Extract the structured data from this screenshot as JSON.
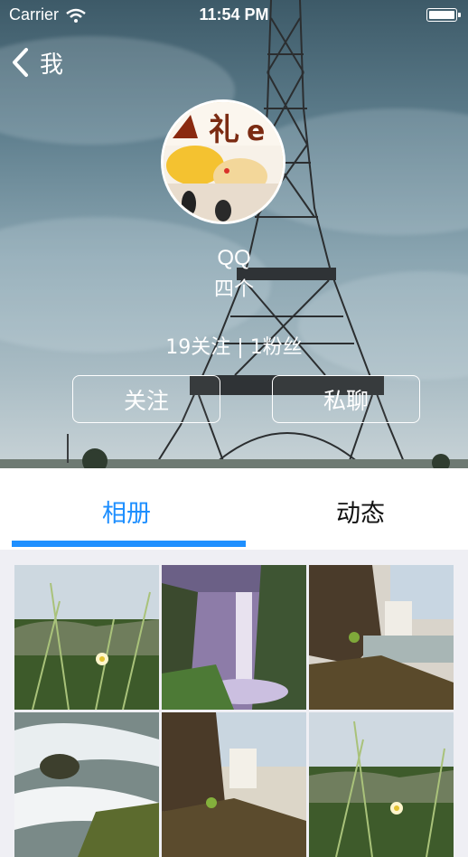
{
  "status_bar": {
    "carrier": "Carrier",
    "time": "11:54 PM"
  },
  "nav": {
    "back_label": "我"
  },
  "profile": {
    "name": "QQ",
    "subtitle": "四个",
    "counts": "19关注 | 1粉丝",
    "follow_label": "关注",
    "message_label": "私聊"
  },
  "tabs": [
    {
      "label": "相册",
      "active": true
    },
    {
      "label": "动态",
      "active": false
    }
  ],
  "photos": [
    {
      "scene": "meadow-flower"
    },
    {
      "scene": "waterfall-purple"
    },
    {
      "scene": "waterfall-cliff"
    },
    {
      "scene": "stream-rocks"
    },
    {
      "scene": "waterfall-cliff-2"
    },
    {
      "scene": "meadow-flower-2"
    }
  ],
  "colors": {
    "accent": "#1e8fff",
    "tab_inactive": "#111111",
    "page_bg": "#efeff4"
  }
}
